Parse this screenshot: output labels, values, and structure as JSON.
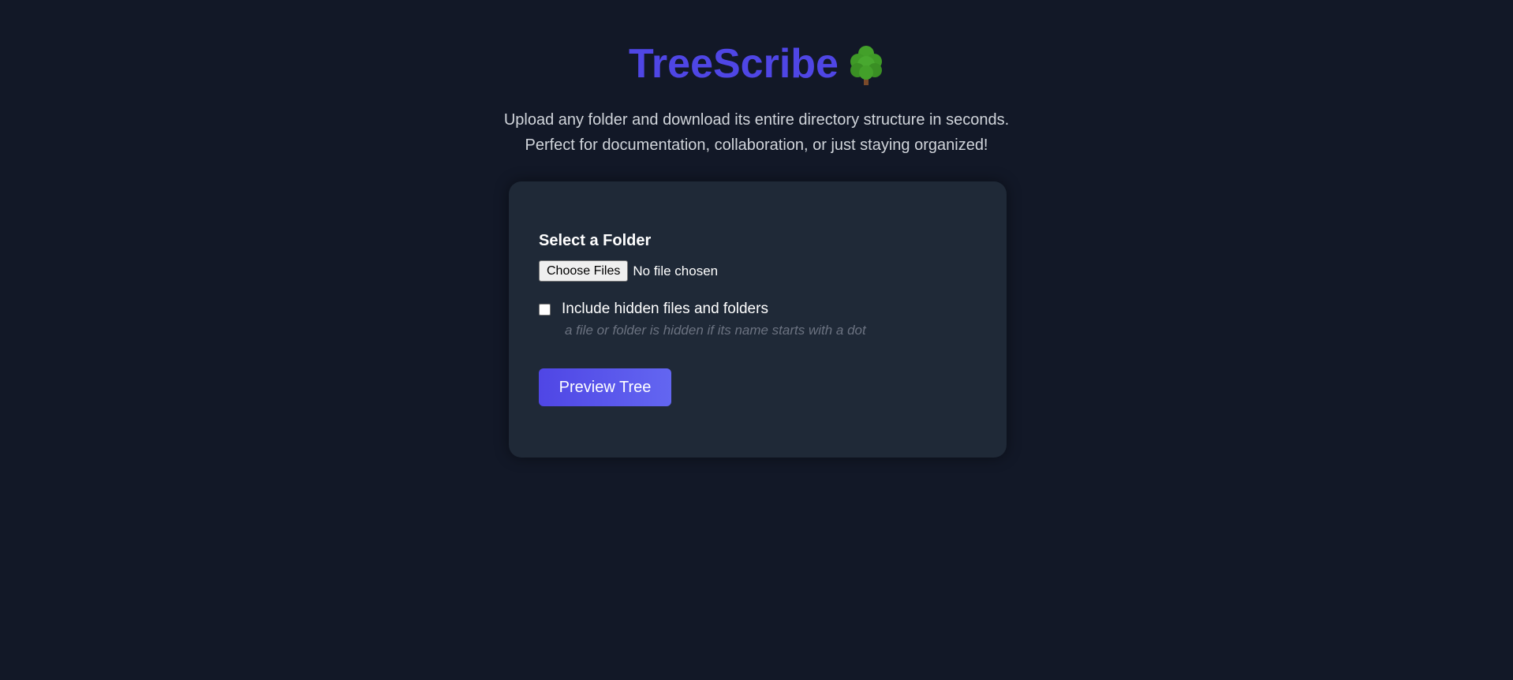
{
  "header": {
    "title": "TreeScribe",
    "title_icon": "deciduous-tree-emoji",
    "subtitle_line1": "Upload any folder and download its entire directory structure in seconds.",
    "subtitle_line2": "Perfect for documentation, collaboration, or just staying organized!"
  },
  "form": {
    "section_label": "Select a Folder",
    "choose_button_label": "Choose Files",
    "file_status": "No file chosen",
    "include_hidden_label": "Include hidden files and folders",
    "include_hidden_checked": false,
    "hint": "a file or folder is hidden if its name starts with a dot",
    "preview_button_label": "Preview Tree"
  },
  "colors": {
    "background": "#121827",
    "card": "#1f2937",
    "accent": "#4f46e5",
    "accent_light": "#6366f1",
    "muted_text": "#6b7280",
    "subtitle_text": "#d1d5db"
  }
}
